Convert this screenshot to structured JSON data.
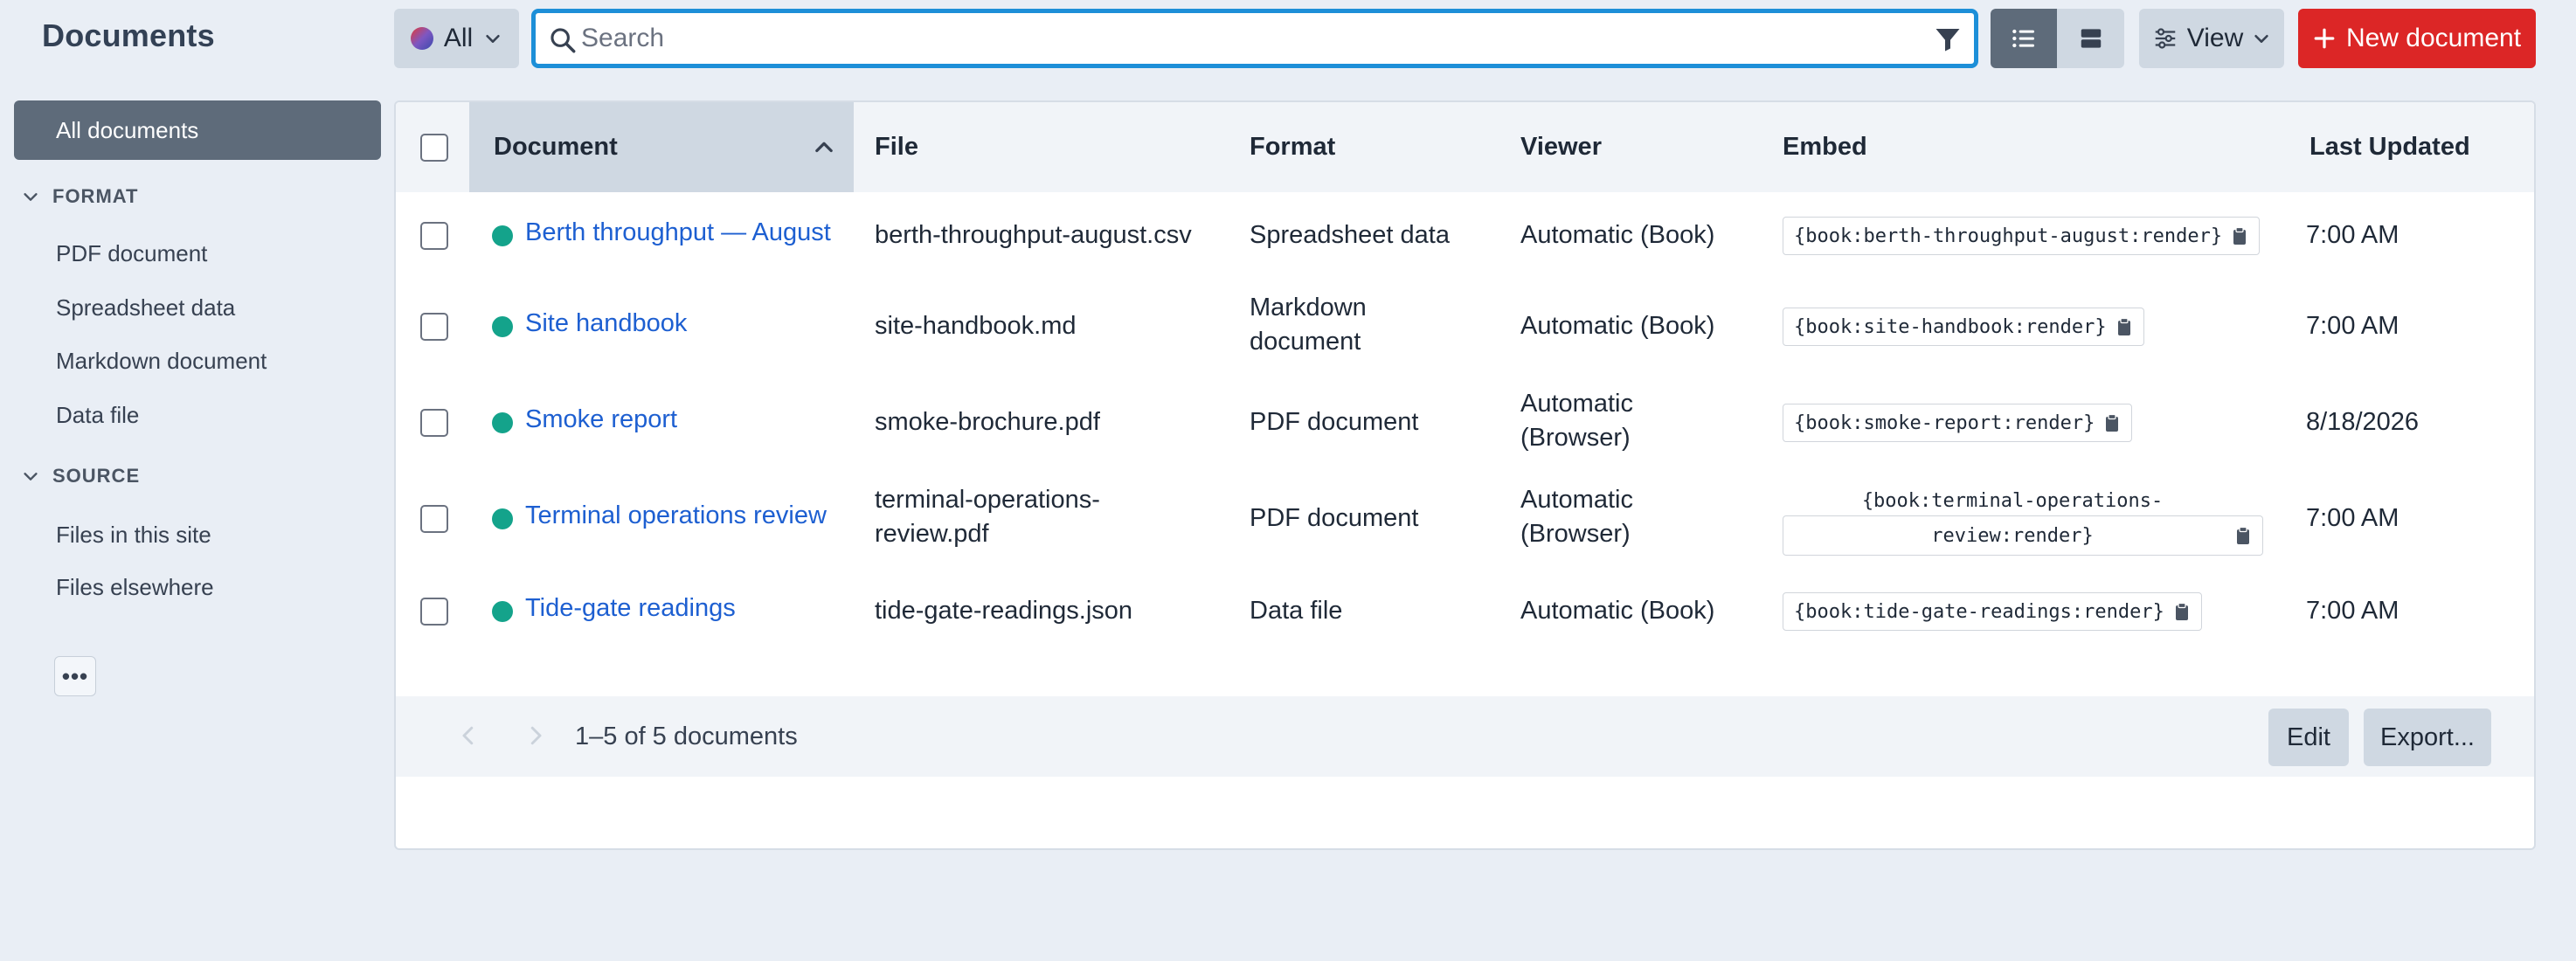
{
  "sidebar": {
    "title": "Documents",
    "all_label": "All documents",
    "sections": [
      {
        "label": "FORMAT",
        "items": [
          "PDF document",
          "Spreadsheet data",
          "Markdown document",
          "Data file"
        ]
      },
      {
        "label": "SOURCE",
        "items": [
          "Files in this site",
          "Files elsewhere"
        ]
      }
    ],
    "more_label": "•••"
  },
  "toolbar": {
    "scope_label": "All",
    "search_placeholder": "Search",
    "search_value": "",
    "view_label": "View",
    "new_label": "New document",
    "colors": {
      "accent": "#1d8fd8",
      "primary": "#dc2626",
      "selected": "#5e6b7a"
    }
  },
  "table": {
    "columns": {
      "document": "Document",
      "file": "File",
      "format": "Format",
      "viewer": "Viewer",
      "embed": "Embed",
      "updated": "Last Updated"
    },
    "sort": {
      "column": "Document",
      "direction": "ascending"
    },
    "rows": [
      {
        "name": "Berth throughput — August",
        "file": "berth-throughput-august.csv",
        "format": "Spreadsheet data",
        "viewer": "Automatic (Book)",
        "embed": "{book:berth-throughput-august:render}",
        "updated": "7:00 AM"
      },
      {
        "name": "Site handbook",
        "file": "site-handbook.md",
        "format_line1": "Markdown",
        "format_line2": "document",
        "viewer": "Automatic (Book)",
        "embed": "{book:site-handbook:render}",
        "updated": "7:00 AM"
      },
      {
        "name": "Smoke report",
        "file": "smoke-brochure.pdf",
        "format": "PDF document",
        "viewer_line1": "Automatic",
        "viewer_line2": "(Browser)",
        "embed": "{book:smoke-report:render}",
        "updated": "8/18/2026"
      },
      {
        "name": "Terminal operations review",
        "file_line1": "terminal-operations-",
        "file_line2": "review.pdf",
        "format": "PDF document",
        "viewer_line1": "Automatic",
        "viewer_line2": "(Browser)",
        "embed_line1": "{book:terminal-operations-",
        "embed_line2": "review:render}",
        "updated": "7:00 AM"
      },
      {
        "name": "Tide-gate readings",
        "file": "tide-gate-readings.json",
        "format": "Data file",
        "viewer": "Automatic (Book)",
        "embed": "{book:tide-gate-readings:render}",
        "updated": "7:00 AM"
      }
    ],
    "status_color": "#14a38b"
  },
  "footer": {
    "range_text": "1–5 of 5 documents",
    "edit_label": "Edit",
    "export_label": "Export..."
  }
}
